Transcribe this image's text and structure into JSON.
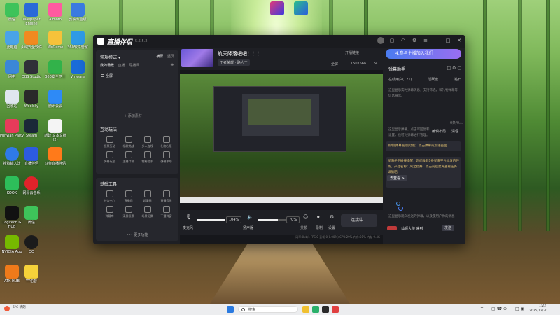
{
  "app": {
    "name": "直播伴侣",
    "version": "5.5.5.2",
    "mode_label": "常规模式 ▾",
    "mode_tabs": [
      "横屏",
      "竖屏"
    ],
    "scene_tabs": [
      "我的场景",
      "直播",
      "导播间"
    ],
    "scene_item": "全屏",
    "add_material": "+ 添加素材",
    "interact_title": "互动玩法",
    "interact_items": [
      "投票互动",
      "福袋挑战",
      "多人连线",
      "礼物心愿",
      "弹幕玩法",
      "主播口袋",
      "钻粉助手",
      "弹幕求助"
    ],
    "tools_title": "基础工具",
    "tools_items": [
      "任务中心",
      "直播间",
      "超清画",
      "直播音乐",
      "弹幕库",
      "清屏投票",
      "场景切换",
      "下播弹窗"
    ],
    "more_label": "••• 更多功能"
  },
  "live": {
    "title": "航天降落吧吧！！！",
    "category_tag": "王者荣耀 · 路人王",
    "right_top": "开播链接",
    "full_screen": "全屏",
    "viewers": "1507566",
    "count2": "24"
  },
  "controls": {
    "mic_label": "麦克风",
    "mic_pct": "104%",
    "speaker_label": "扬声器",
    "speaker_pct": "70%",
    "effect_label": "美颜",
    "record_label": "录制",
    "settings_label": "设置",
    "go_live": "连接中...",
    "stats": "码率:0kb/s  FPS:0  丢帧:0(0.00%)  CPU:29%  内存:21%  内存 9.4G"
  },
  "right_panel": {
    "banner": "4.参与主播加入我们",
    "header": "弹幕助手",
    "tabs": [
      "在线用户(121)",
      "活跃度",
      "钻石"
    ],
    "tip1": "这里显示实时弹幕消息，支持筛选，和礼物弹幕等信息展示。",
    "counter": "0条/0人",
    "btn_edit": "编辑布局",
    "btn_clear": "清理",
    "tip2": "这里显示弹幕，点击可回复和设置，也可对弹幕进行管理。",
    "notice1": "新增[弹幕置顶]功能，点击弹幕或加进画面",
    "notice2": "星海任务碰撞提醒：您们收到1条星海平台派发的任务，产品名称：风之猎舞，点击前往星海查看任务详情吧。",
    "check_btn": "去查看 >",
    "tip3": "这里显示观众发送的弹幕，以及使用户你的消息",
    "input_label": "仙顺大侠 来啦",
    "send": "发送"
  },
  "desktop": {
    "icons": [
      "微信",
      "Wallpaper Engine",
      "Aimoto",
      "剪映专业版",
      "此电脑",
      "火绒安全软件",
      "WeGame",
      "360软件管家",
      "网络",
      "OBS Studio",
      "360安全卫士",
      "Vmware",
      "回收站",
      "Woolsky",
      "腾讯会议",
      "",
      "Punwan Party",
      "Steam",
      "新建 文本文档 (2)",
      "",
      "搜狗输入法",
      "直播伴侣",
      "斗鱼直播伴侣",
      "",
      "KOOK",
      "网易云音乐",
      "",
      "",
      "Logitech G HUB",
      "微信",
      "",
      "",
      "NVIDIA App",
      "QQ",
      "",
      "",
      "ATK HUB",
      "YY语音",
      "",
      ""
    ]
  },
  "taskbar": {
    "search": "搜索",
    "weather": "6°C 晴朗",
    "time": "1:22",
    "date": "2025/12/30"
  },
  "colors": {
    "accent": "#4a7cf0",
    "window_bg": "#1e1f24",
    "card_bg": "#26272d"
  }
}
